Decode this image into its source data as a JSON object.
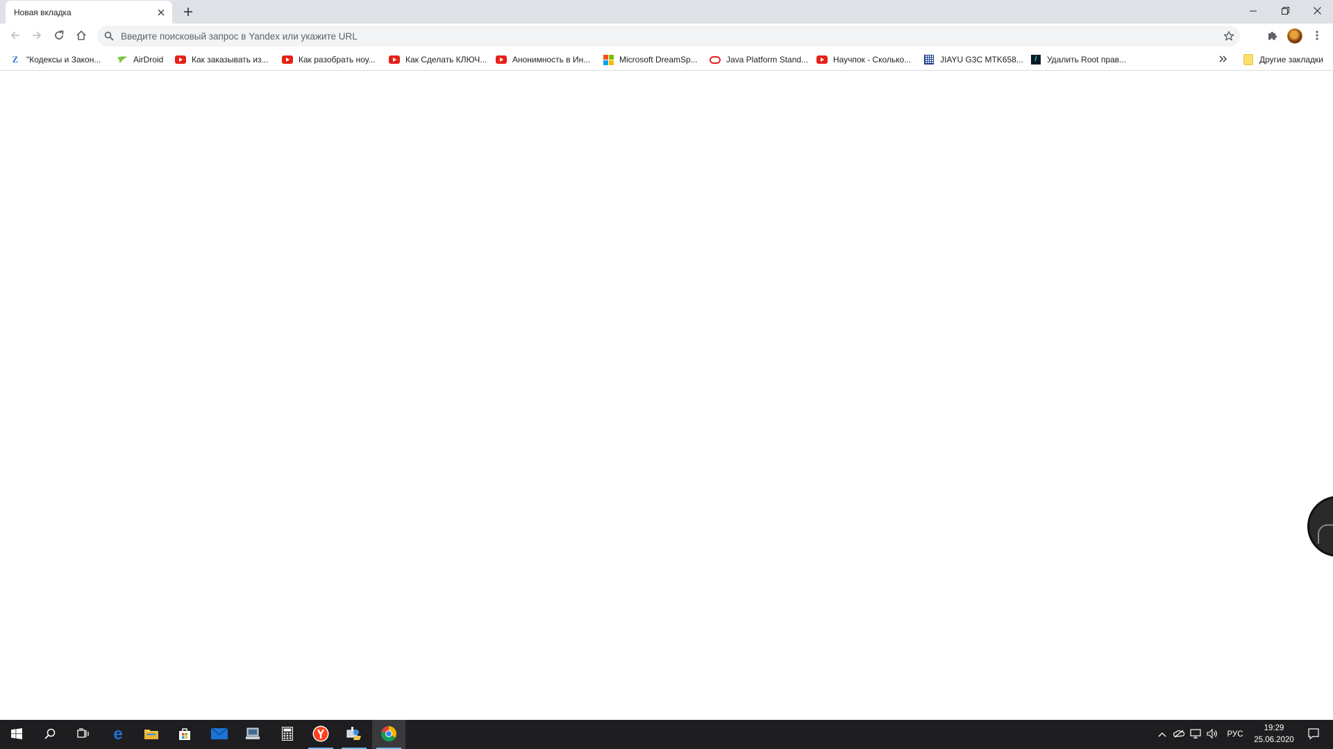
{
  "tab": {
    "title": "Новая вкладка"
  },
  "omnibox": {
    "placeholder": "Введите поисковый запрос в Yandex или укажите URL"
  },
  "bookmarks": [
    {
      "label": "\"Кодексы и Закон...",
      "icon": "z-icon"
    },
    {
      "label": "AirDroid",
      "icon": "airdroid-icon"
    },
    {
      "label": "Как заказывать из...",
      "icon": "youtube-icon"
    },
    {
      "label": "Как разобрать ноу...",
      "icon": "youtube-icon"
    },
    {
      "label": "Как Сделать КЛЮЧ...",
      "icon": "youtube-icon"
    },
    {
      "label": "Анонимность в Ин...",
      "icon": "youtube-icon"
    },
    {
      "label": "Microsoft DreamSp...",
      "icon": "microsoft-icon"
    },
    {
      "label": "Java Platform Stand...",
      "icon": "oracle-icon"
    },
    {
      "label": "Научпок - Сколько...",
      "icon": "youtube-icon"
    },
    {
      "label": "JIAYU G3C MTK658...",
      "icon": "grid-icon"
    },
    {
      "label": "Удалить Root прав...",
      "icon": "site-icon"
    }
  ],
  "other_bookmarks": "Другие закладки",
  "taskbar": {
    "language": "РУС",
    "time": "19:29",
    "date": "25.06.2020"
  },
  "colors": {
    "tabstrip": "#dee1e6",
    "omnibox": "#f1f3f4",
    "taskbar": "#1e1e20",
    "edge_blue": "#1e74d6",
    "youtube_red": "#e62117"
  }
}
